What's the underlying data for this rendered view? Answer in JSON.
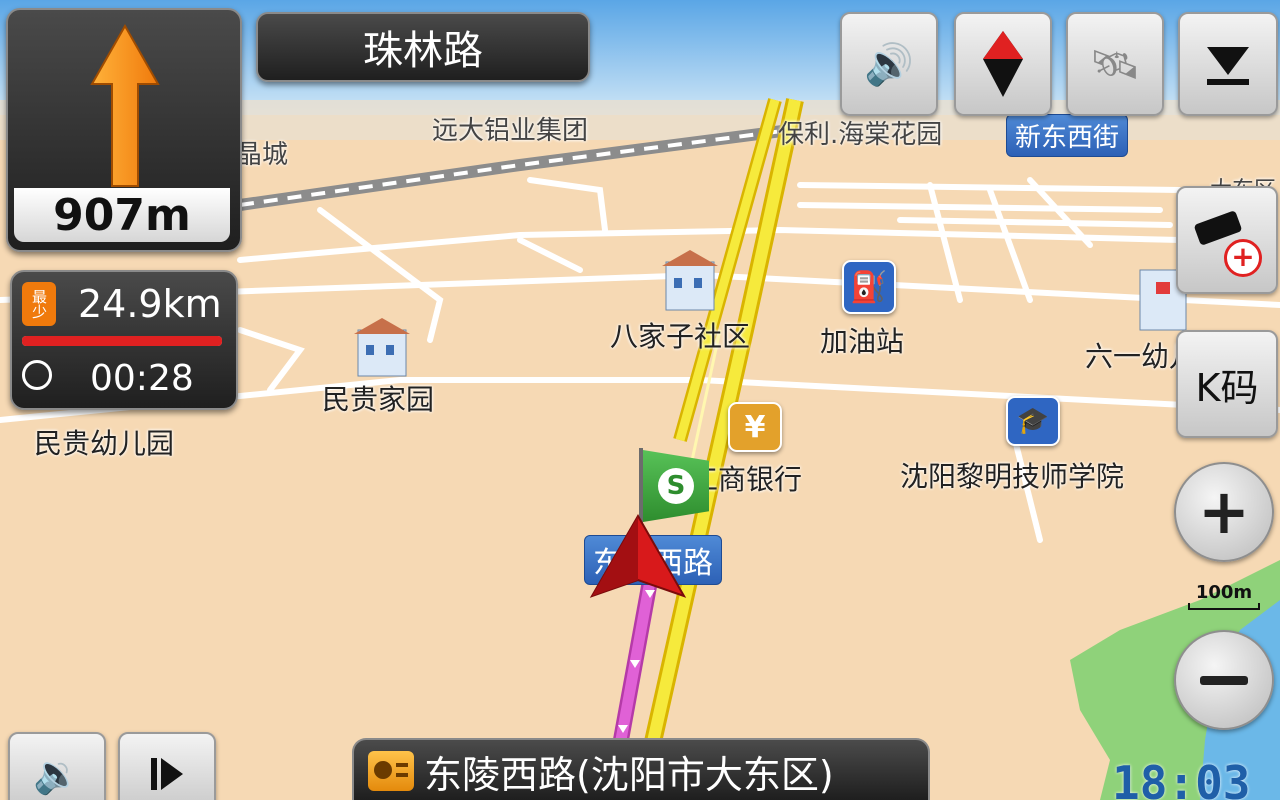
{
  "guidance": {
    "turn_distance": "907m",
    "current_road": "珠林路",
    "remaining_distance": "24.9km",
    "route_mode_badge": "最少",
    "eta_time": "00:28",
    "next_road": "东陵西路(沈阳市大东区)",
    "clock": "18:03"
  },
  "toolbar": {
    "voice_icon": "speaker-chat-icon",
    "compass_icon": "compass-icon",
    "satellite_icon": "satellite-icon",
    "menu_icon": "collapse-down-icon",
    "camera_add_icon": "camera-add-icon",
    "kcode_label": "K码"
  },
  "map": {
    "scale_label": "100m",
    "pois": [
      {
        "id": "poi-yuanda",
        "label": "远大铝业集团"
      },
      {
        "id": "poi-baoli",
        "label": "保利.海棠花园"
      },
      {
        "id": "poi-bajiazi",
        "label": "八家子社区"
      },
      {
        "id": "poi-jiayou",
        "label": "加油站"
      },
      {
        "id": "poi-liuyi",
        "label": "六一幼儿园"
      },
      {
        "id": "poi-mingui",
        "label": "民贵家园"
      },
      {
        "id": "poi-minguiyou",
        "label": "民贵幼儿园"
      },
      {
        "id": "poi-gongshang",
        "label": "工商银行"
      },
      {
        "id": "poi-shenyang",
        "label": "沈阳黎明技师学院"
      },
      {
        "id": "poi-cheng",
        "label": "晶城"
      },
      {
        "id": "poi-dadong",
        "label": "大东区"
      }
    ],
    "road_signs": {
      "xindongxi": "新东西街",
      "dongling": "东陵西路"
    },
    "start_flag": "S"
  },
  "colors": {
    "route": "#e061d6",
    "highway": "#f6ea3c",
    "land": "#f6d9b4",
    "water": "#6bb8e8",
    "park": "#8fd27a"
  }
}
